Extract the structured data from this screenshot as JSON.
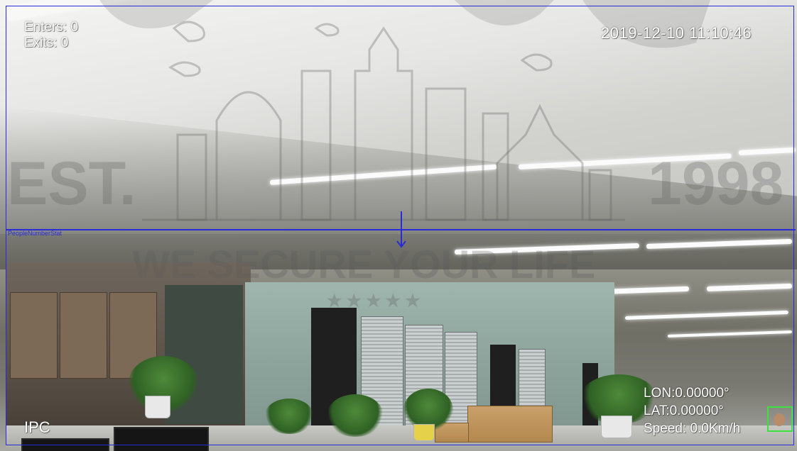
{
  "osd": {
    "enters": "Enters: 0",
    "exits": "Exits: 0",
    "timestamp": "2019-12-10 11:10:46",
    "camera_name": "IPC",
    "gps": {
      "lon": "LON:0.00000°",
      "lat": "LAT:0.00000°",
      "speed": "Speed: 0.0Km/h"
    },
    "line_label": "PeopleNumberStat"
  },
  "watermark": {
    "est": "EST.",
    "year": "1998",
    "slogan": "WE SECURE YOUR LIFE",
    "stars": "★★★★★"
  },
  "colors": {
    "rule_line": "#2a2ad8",
    "face_box": "#3ee23e",
    "osd_text": "#ffffff"
  }
}
